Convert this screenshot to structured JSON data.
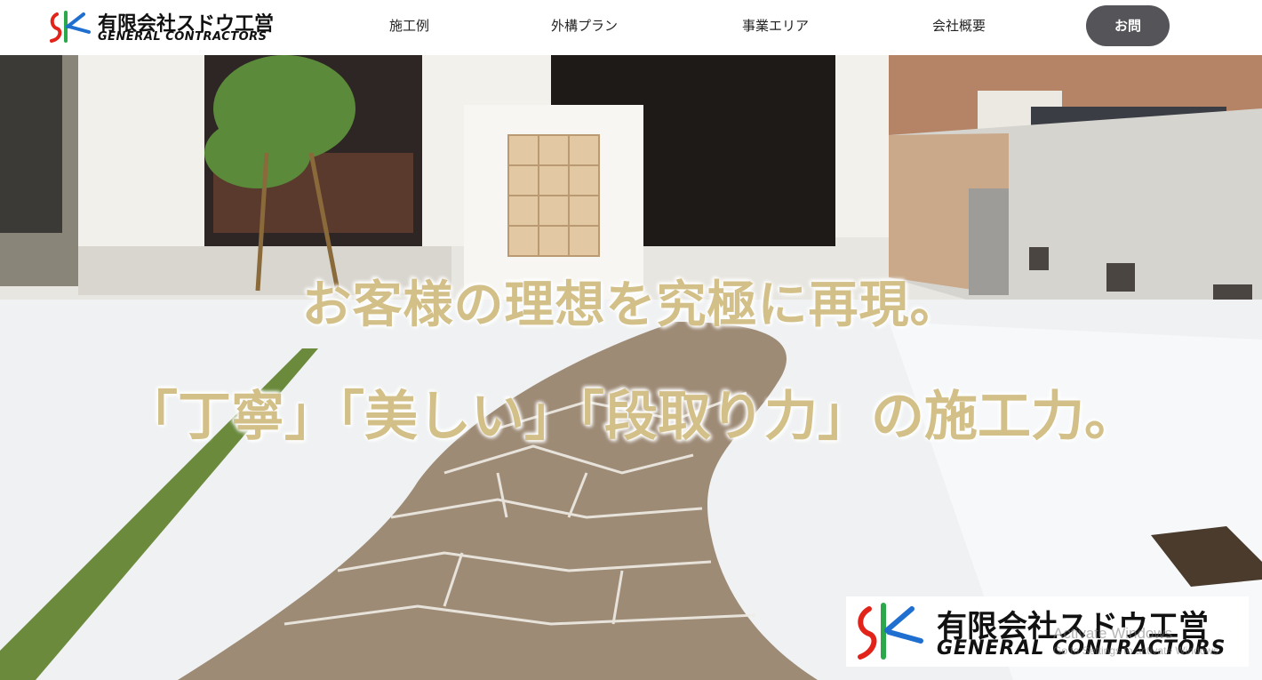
{
  "header": {
    "logo": {
      "name_jp": "有限会社スドウ工営",
      "name_en": "GENERAL CONTRACTORS"
    },
    "nav": [
      {
        "label": "施工例"
      },
      {
        "label": "外構プラン"
      },
      {
        "label": "事業エリア"
      },
      {
        "label": "会社概要"
      }
    ],
    "contact_label": "お問"
  },
  "hero": {
    "headline_1": "お客様の理想を究極に再現。",
    "headline_2": "「丁寧」「美しい」「段取り力」の施工力。",
    "headline_color": "#d3c089",
    "badge": {
      "name_jp": "有限会社スドウ工営",
      "name_en": "GENERAL CONTRACTORS"
    }
  },
  "watermark": {
    "line1": "Activate Windows",
    "line2": "Go to Settings to activate Windows."
  },
  "colors": {
    "contact_button": "#555459",
    "logo_red": "#e2231a",
    "logo_green": "#2aa84a",
    "logo_blue": "#1f6fd1"
  }
}
